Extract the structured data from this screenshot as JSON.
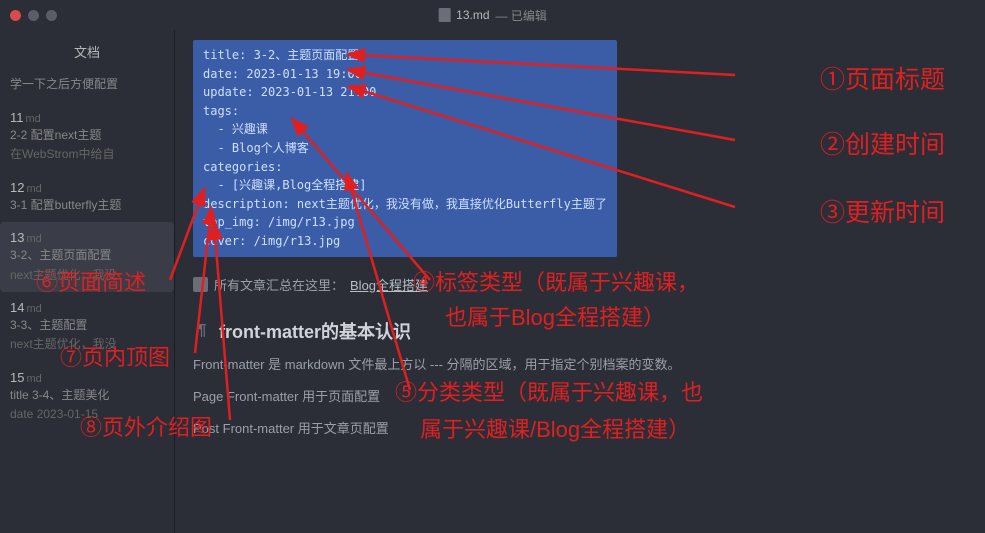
{
  "window": {
    "filename": "13.md",
    "status": "— 已编辑"
  },
  "sidebar": {
    "title": "文档",
    "top_note": "学一下之后方便配置",
    "items": [
      {
        "num": "11",
        "ext": "md",
        "l1": "2-2 配置next主题",
        "l2": "在WebStrom中给自"
      },
      {
        "num": "12",
        "ext": "md",
        "l1": "3-1 配置butterfly主题",
        "l2": ""
      },
      {
        "num": "13",
        "ext": "md",
        "l1": "3-2、主题页面配置",
        "l2": "next主题优化，我没"
      },
      {
        "num": "14",
        "ext": "md",
        "l1": "3-3、主题配置",
        "l2": "next主题优化，我没"
      },
      {
        "num": "15",
        "ext": "md",
        "l1": "title  3-4、主题美化",
        "l2": "date  2023-01-15"
      }
    ]
  },
  "frontmatter": {
    "l0": "title: 3-2、主题页面配置",
    "l1": "date: 2023-01-13 19:00",
    "l2": "update: 2023-01-13 21:00",
    "l3": "tags:",
    "l4": "  - 兴趣课",
    "l5": "  - Blog个人博客",
    "l6": "categories:",
    "l7": "  - [兴趣课,Blog全程搭建]",
    "l8": "description: next主题优化，我没有做，我直接优化Butterfly主题了",
    "l9": "top_img: /img/r13.jpg",
    "l10": "cover: /img/r13.jpg"
  },
  "content": {
    "allposts_prefix": "所有文章汇总在这里：",
    "allposts_link": "Blog全程搭建",
    "heading": "front-matter的基本认识",
    "para1": "Front-matter 是 markdown 文件最上方以 --- 分隔的区域，用于指定个别档案的变数。",
    "para2": "Page Front-matter 用于页面配置",
    "para3": "Post Front-matter 用于文章页配置"
  },
  "annotations": {
    "a1": "①页面标题",
    "a2": "②创建时间",
    "a3": "③更新时间",
    "a4a": "④标签类型（既属于兴趣课，",
    "a4b": "也属于Blog全程搭建）",
    "a5a": "⑤分类类型（既属于兴趣课，也",
    "a5b": "属于兴趣课/Blog全程搭建）",
    "a6": "⑥页面简述",
    "a7": "⑦页内顶图",
    "a8": "⑧页外介绍图"
  },
  "colors": {
    "annot": "#e02020",
    "bg": "#2b2e37",
    "hl": "#3b5ca7"
  }
}
